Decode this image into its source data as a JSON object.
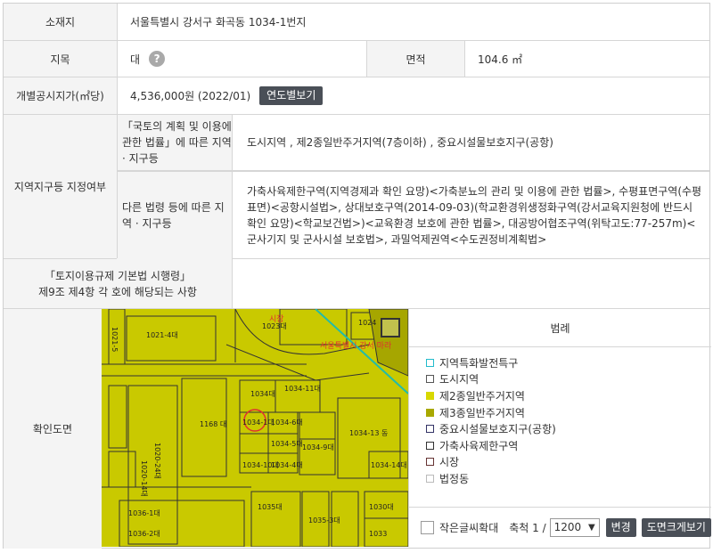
{
  "location": {
    "label": "소재지",
    "value": "서울특별시 강서구 화곡동 1034-1번지"
  },
  "land_category": {
    "label": "지목",
    "value": "대",
    "help_icon": "question-icon"
  },
  "area": {
    "label": "면적",
    "value": "104.6 ㎡"
  },
  "price": {
    "label": "개별공시지가(㎡당)",
    "value": "4,536,000원 (2022/01)",
    "button": "연도별보기"
  },
  "zoning": {
    "label": "지역지구등 지정여부",
    "national_law": {
      "label": "「국토의 계획 및 이용에 관한 법률」에 따른 지역 · 지구등",
      "value": "도시지역 , 제2종일반주거지역(7층이하) , 중요시설물보호지구(공항)"
    },
    "other_law": {
      "label": "다른 법령 등에 따른 지역 · 지구등",
      "value": "가축사육제한구역(지역경제과 확인 요망)<가축분뇨의 관리 및 이용에 관한 법률>, 수평표면구역(수평표면)<공항시설법>, 상대보호구역(2014-09-03)(학교환경위생정화구역(강서교육지원청에 반드시 확인 요망)<학교보건법>)<교육환경 보호에 관한 법률>, 대공방어협조구역(위탁고도:77-257m)<군사기지 및 군사시설 보호법>, 과밀억제권역<수도권정비계획법>"
    }
  },
  "enforcement": {
    "label_line1": "「토지이용규제 기본법 시행령」",
    "label_line2": "제9조 제4항 각 호에 해당되는 사항",
    "value": ""
  },
  "map": {
    "label": "확인도면",
    "expand_icon": "fullscreen-icon",
    "parcels": [
      "1021-4대",
      "1023대",
      "1024",
      "1034대",
      "1034-11대",
      "1168 대",
      "1034-1대",
      "1034-6대",
      "1034-5대",
      "1034-9대",
      "1034-10대",
      "1034-4대",
      "1034-13 동",
      "1034-14대",
      "1035대",
      "1035-3대",
      "1036-1대",
      "1036-2대",
      "1030대",
      "1033",
      "1020-14대",
      "1020-24대",
      "1021-5"
    ],
    "annotations": [
      "시장",
      "서울특별시 강서 마라"
    ]
  },
  "legend": {
    "title": "범례",
    "items": [
      {
        "label": "지역특화발전특구",
        "color": "#ffffff",
        "border": "#22bbcc"
      },
      {
        "label": "도시지역",
        "color": "#ffffff",
        "border": "#555555"
      },
      {
        "label": "제2종일반주거지역",
        "color": "#d8d800",
        "border": "#d8d800"
      },
      {
        "label": "제3종일반주거지역",
        "color": "#a8a800",
        "border": "#a8a800"
      },
      {
        "label": "중요시설물보호지구(공항)",
        "color": "#ffffff",
        "border": "#333366"
      },
      {
        "label": "가축사육제한구역",
        "color": "#ffffff",
        "border": "#333333"
      },
      {
        "label": "시장",
        "color": "#ffffff",
        "border": "#663333"
      },
      {
        "label": "법정동",
        "color": "#ffffff",
        "border": "#bbbbbb"
      }
    ]
  },
  "controls": {
    "small_font_label": "작은글씨확대",
    "scale_label": "축척 1 /",
    "scale_value": "1200",
    "change_button": "변경",
    "print_button": "도면크게보기"
  }
}
